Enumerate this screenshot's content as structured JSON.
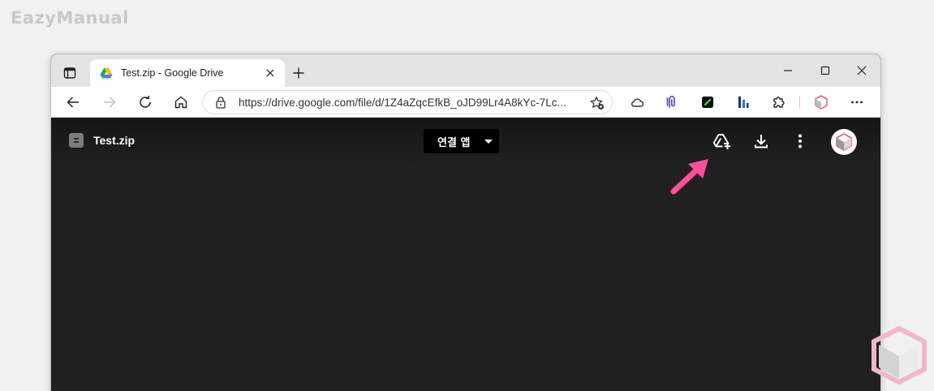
{
  "watermark": {
    "text": "EazyManual"
  },
  "browser": {
    "tab": {
      "title": "Test.zip - Google Drive"
    },
    "address_bar": {
      "url": "https://drive.google.com/file/d/1Z4aZqcEfkB_oJD99Lr4A8kYc-7Lc..."
    }
  },
  "viewer": {
    "file_name": "Test.zip",
    "open_with_label": "연결 앱"
  },
  "colors": {
    "highlight_arrow": "#ff4f9a",
    "viewer_background": "#202020",
    "tabbar_background": "#e3e3e3"
  },
  "icons": {
    "tab_actions": "tab-actions-icon",
    "favicon": "google-drive-icon",
    "add_to_drive": "add-to-drive-icon",
    "download": "download-icon",
    "more": "more-vert-icon"
  }
}
